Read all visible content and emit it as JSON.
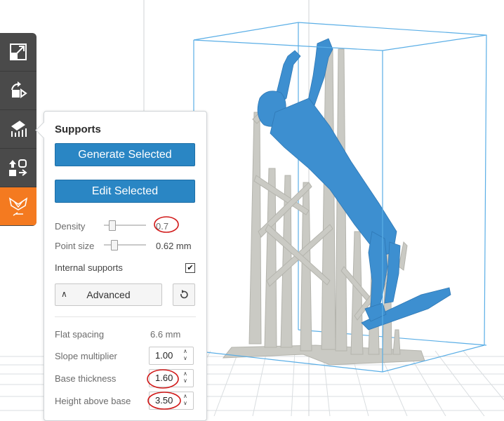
{
  "panel": {
    "title": "Supports",
    "generate_label": "Generate Selected",
    "edit_label": "Edit Selected",
    "density": {
      "label": "Density",
      "value": "0.7"
    },
    "point_size": {
      "label": "Point size",
      "value": "0.62 mm"
    },
    "internal": {
      "label": "Internal supports",
      "checked_glyph": "✔"
    },
    "advanced": {
      "label": "Advanced",
      "chevron": "∧"
    },
    "flat_spacing": {
      "label": "Flat spacing",
      "value": "6.6 mm"
    },
    "slope": {
      "label": "Slope multiplier",
      "value": "1.00"
    },
    "base_thickness": {
      "label": "Base thickness",
      "value": "1.60"
    },
    "height_above": {
      "label": "Height above base",
      "value": "3.50"
    }
  },
  "toolbar": {
    "tools": [
      {
        "icon": "scale-icon"
      },
      {
        "icon": "rotate-icon"
      },
      {
        "icon": "supports-icon"
      },
      {
        "icon": "layout-icon"
      },
      {
        "icon": "preform-icon"
      }
    ]
  },
  "colors": {
    "accent": "#2a86c4",
    "toolbar_bg": "#4a4a4a",
    "active_tool": "#f47a20",
    "model": "#3d8fd0",
    "supports": "#c9c9c2",
    "annotation": "#d11919"
  }
}
